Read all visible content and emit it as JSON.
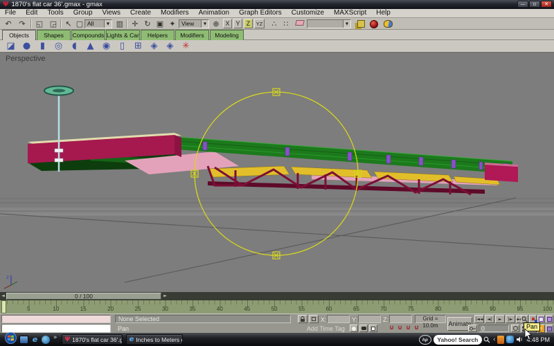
{
  "window": {
    "title": "1870's flat car 36'.gmax - gmax"
  },
  "menu": {
    "items": [
      "File",
      "Edit",
      "Tools",
      "Group",
      "Views",
      "Create",
      "Modifiers",
      "Animation",
      "Graph Editors",
      "Customize",
      "MAXScript",
      "Help"
    ]
  },
  "toolbar": {
    "selection_filter": "All",
    "coord_system": "View",
    "axis_x": "X",
    "axis_y": "Y",
    "axis_z": "Z",
    "axis_plane": "YZ",
    "named_selection_value": ""
  },
  "icons": {
    "undo": "↶",
    "redo": "↷",
    "link": "◱",
    "unlink": "◲",
    "select": "↖",
    "region": "▢",
    "window_crossing": "▥",
    "move": "✛",
    "rotate": "↻",
    "scale": "▣",
    "manipulate": "✦",
    "pivot": "⊕",
    "mirror": "∴",
    "array": "∷",
    "dropdown_arrow": "▼",
    "left_arrow": "◄",
    "right_arrow": "►",
    "overflow": "»",
    "collapse": "‹",
    "snap_magnet": "∪",
    "gmax_logo": "Ψ",
    "minimize": "—",
    "maximize": "▫",
    "close": "✕",
    "ie": "e"
  },
  "tabs": {
    "items": [
      {
        "label": "Objects",
        "cls": "active"
      },
      {
        "label": "Shapes"
      },
      {
        "label": "Compounds"
      },
      {
        "label": "Lights & Cameras"
      },
      {
        "label": "Helpers"
      },
      {
        "label": "Modifiers"
      },
      {
        "label": "Modeling"
      }
    ]
  },
  "object_icons": {
    "items": [
      {
        "glyph": "◪"
      },
      {
        "glyph": "●"
      },
      {
        "glyph": "▮"
      },
      {
        "glyph": "◎"
      },
      {
        "glyph": "◖"
      },
      {
        "glyph": "▲"
      },
      {
        "glyph": "◉"
      },
      {
        "glyph": "▯"
      },
      {
        "glyph": "⊞"
      },
      {
        "glyph": "◈"
      },
      {
        "glyph": "◈"
      },
      {
        "glyph": "✳",
        "cls": "red"
      }
    ]
  },
  "viewport": {
    "label": "Perspective",
    "axis_z_label": "z"
  },
  "trackbar": {
    "value": "0 / 100"
  },
  "ruler": {
    "labels": [
      "5",
      "10",
      "15",
      "20",
      "25",
      "30",
      "35",
      "40",
      "45",
      "50",
      "55",
      "60",
      "65",
      "70",
      "75",
      "80",
      "85",
      "90",
      "95",
      "100"
    ]
  },
  "status": {
    "selection": "None Selected",
    "prompt": "Pan",
    "add_time_tag": "Add Time Tag",
    "x_label": "X:",
    "y_label": "Y:",
    "z_label": "Z:",
    "grid": "Grid = 10.0m",
    "animate": "Animate",
    "frame_value": "0",
    "playback": [
      "|◄◄",
      "◄|",
      "►",
      "|►",
      "►►|"
    ]
  },
  "tooltip": {
    "text": "Pan"
  },
  "taskbar": {
    "buttons": [
      {
        "label": "1870's flat car 36'.g..."
      },
      {
        "label": "Inches to Meters co..."
      }
    ],
    "search": "Yahoo! Search",
    "hp": "hp",
    "clock": "4:48 PM"
  },
  "colors": {
    "tab_green": "#8fbc74",
    "axis_highlight": "#c9cd6c",
    "selection_yellow": "#d6d61e",
    "deck_green": "#1c7a1c",
    "sill_crimson": "#a5194e",
    "end_magenta": "#b01856",
    "plank_yellow": "#e2bf2a",
    "pocket_purple": "#8a50c8",
    "underframe_pink": "#e4a2ba",
    "cream_edge": "#e3dcae",
    "truss_maroon": "#7c0e36",
    "brake_teal": "#62b894",
    "ruler_olive": "#8e9c74"
  }
}
